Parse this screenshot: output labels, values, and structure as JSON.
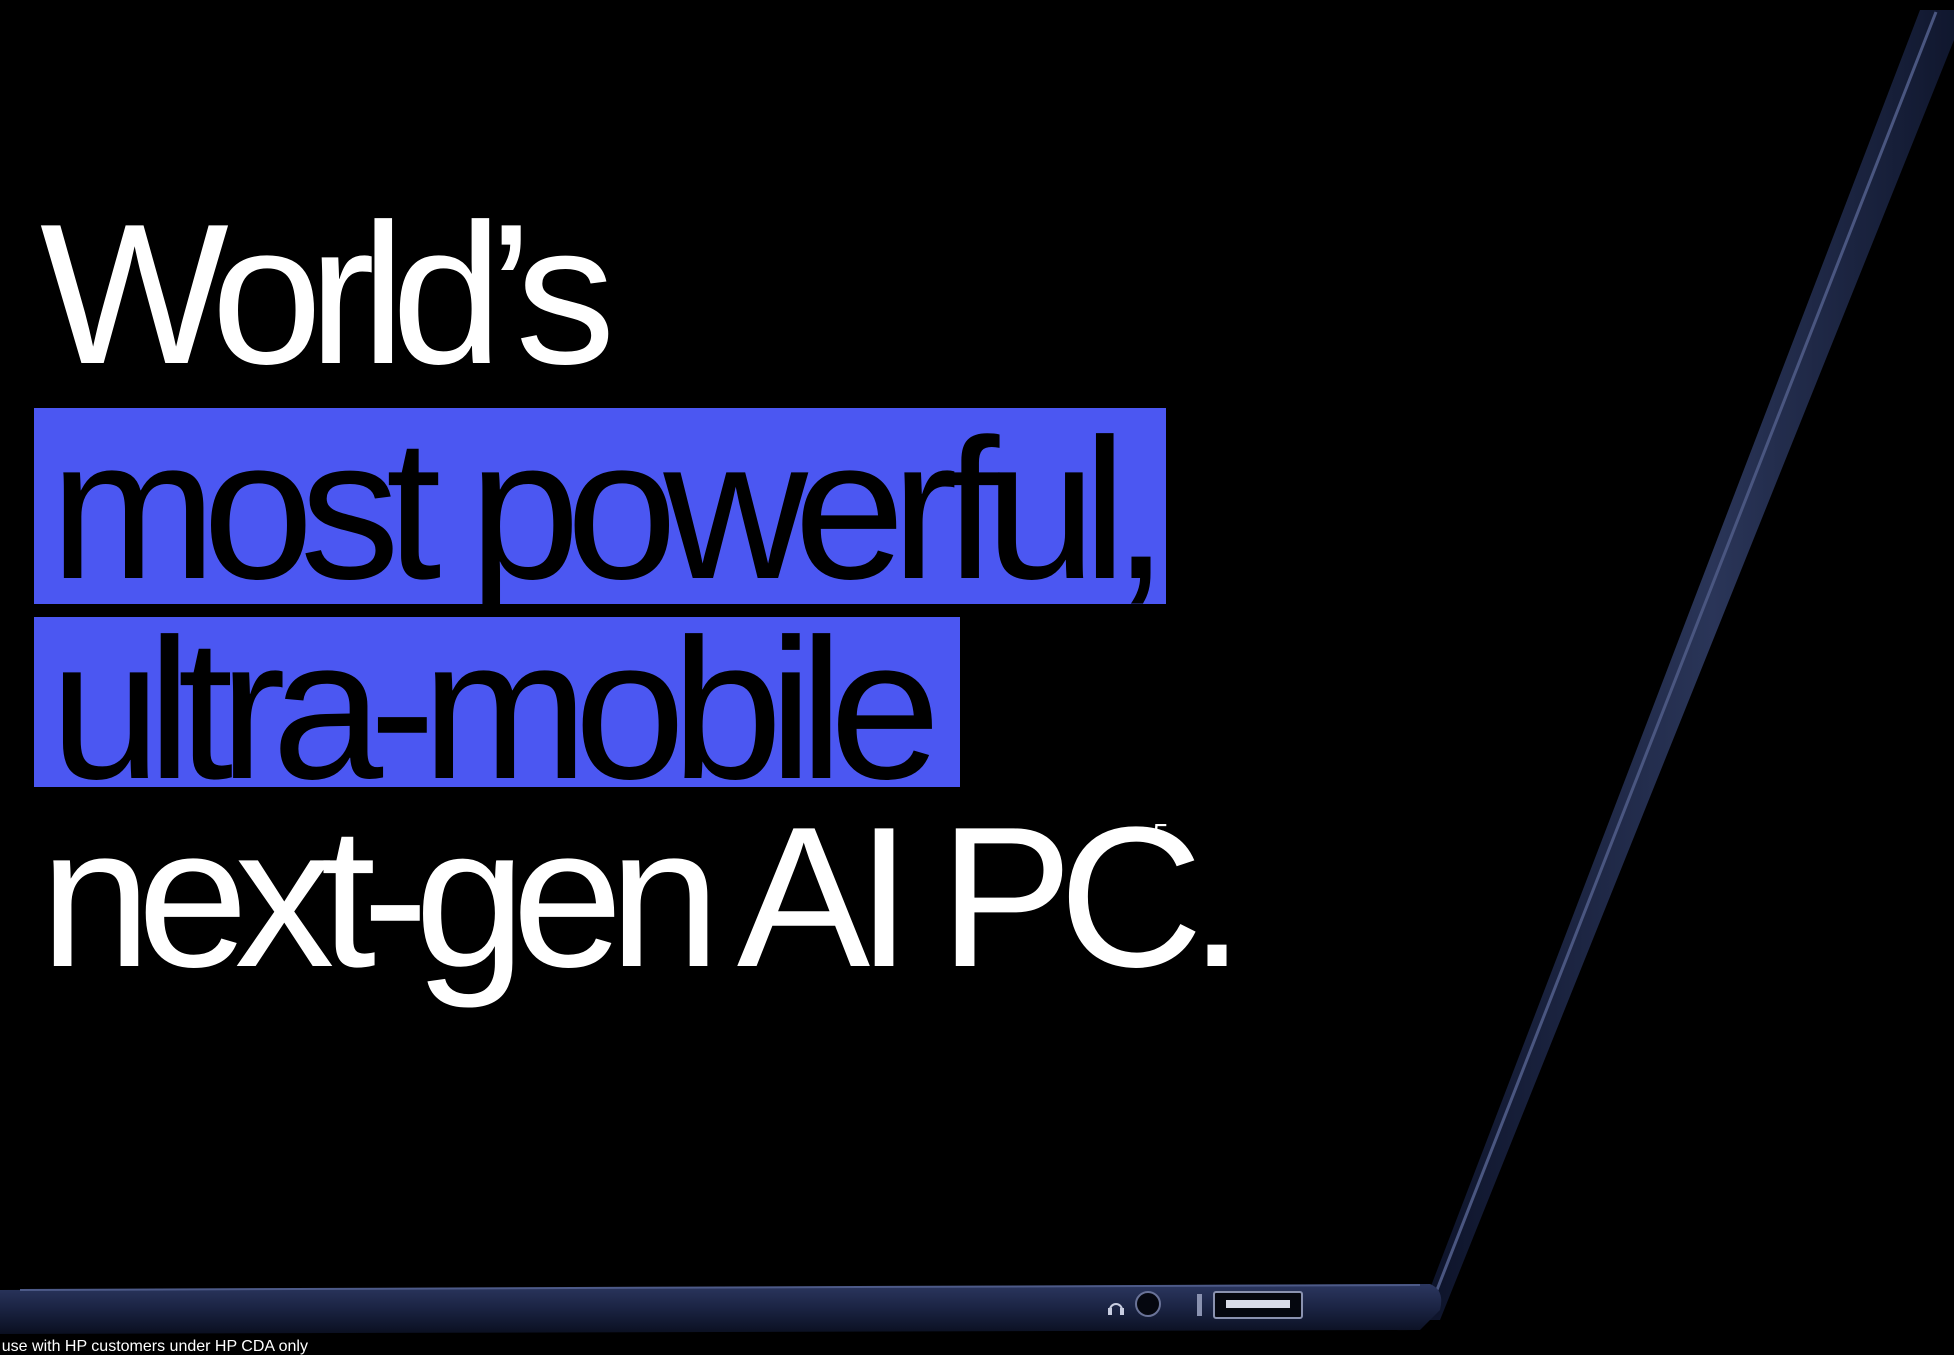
{
  "headline": {
    "line1": "World’s",
    "line2": "most powerful,",
    "line3": "ultra-mobile",
    "line4": "next-gen AI PC.",
    "footnote_marker": "5"
  },
  "footer": {
    "disclaimer": "r use with HP customers under HP CDA only"
  },
  "colors": {
    "background": "#000000",
    "highlight": "#4b57f2",
    "text_light": "#ffffff",
    "text_dark": "#000000",
    "laptop_body": "#1a2342"
  },
  "icons": {
    "headphone_port": "headphone-icon",
    "usb_port": "usb-a-port-icon"
  }
}
